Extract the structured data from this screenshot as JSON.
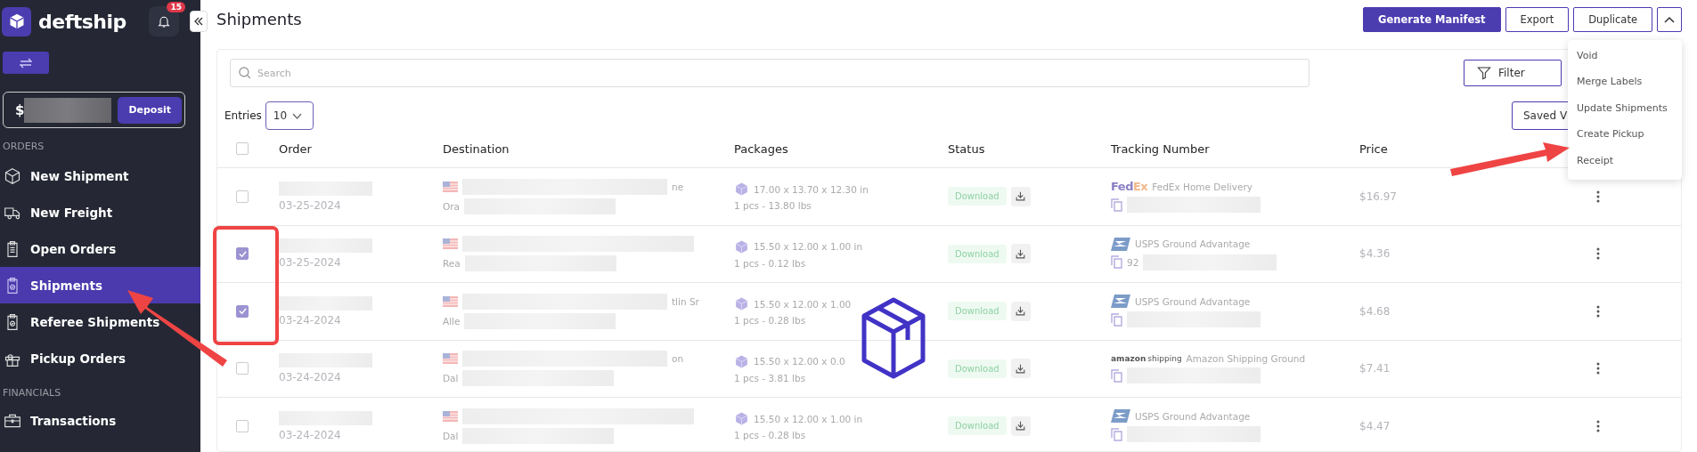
{
  "sidebar": {
    "brand": "deftship",
    "notification_count": "15",
    "balance_symbol": "$",
    "deposit_label": "Deposit",
    "sections": [
      {
        "title": "ORDERS",
        "items": [
          {
            "label": "New Shipment",
            "selected": false
          },
          {
            "label": "New Freight",
            "selected": false
          },
          {
            "label": "Open Orders",
            "selected": false
          },
          {
            "label": "Shipments",
            "selected": true
          },
          {
            "label": "Referee Shipments",
            "selected": false
          },
          {
            "label": "Pickup Orders",
            "selected": false
          }
        ]
      },
      {
        "title": "FINANCIALS",
        "items": [
          {
            "label": "Transactions",
            "selected": false
          }
        ]
      }
    ]
  },
  "page": {
    "title": "Shipments",
    "actions": [
      {
        "label": "Generate Manifest",
        "primary": true
      },
      {
        "label": "Export",
        "primary": false
      },
      {
        "label": "Duplicate",
        "primary": false
      }
    ],
    "menu": {
      "expanded": true,
      "items": [
        "Void",
        "Merge Labels",
        "Update Shipments",
        "Create Pickup",
        "Receipt"
      ]
    }
  },
  "toolbar": {
    "search_placeholder": "Search",
    "filter_label": "Filter",
    "entries_label": "Entries",
    "entries_value": "10",
    "saved_views_label": "Saved V"
  },
  "table": {
    "columns": [
      "Order",
      "Destination",
      "Packages",
      "Status",
      "Tracking Number",
      "Price"
    ],
    "all_selected": false,
    "rows": [
      {
        "selected": false,
        "date": "03-25-2024",
        "dest_start": "Ora",
        "dest_end": "ne",
        "dims": "17.00 x 13.70 x 12.30 in",
        "weight": "1 pcs - 13.80 lbs",
        "status": "Download",
        "kind": "fedex",
        "logo": [
          "Fed",
          "Ex"
        ],
        "service": "FedEx Home Delivery",
        "tracking_start": "",
        "price": "$16.97"
      },
      {
        "selected": true,
        "date": "03-25-2024",
        "dest_start": "Rea",
        "dest_end": "",
        "dims": "15.50 x 12.00 x 1.00 in",
        "weight": "1 pcs - 0.12 lbs",
        "status": "Download",
        "kind": "usps",
        "service": "USPS Ground Advantage",
        "tracking_start": "92",
        "price": "$4.36"
      },
      {
        "selected": true,
        "date": "03-24-2024",
        "dest_start": "Alle",
        "dest_end": "tlin Sr",
        "dims": "15.50 x 12.00 x 1.00",
        "weight": "1 pcs - 0.28 lbs",
        "status": "Download",
        "kind": "usps",
        "service": "USPS Ground Advantage",
        "tracking_start": "",
        "price": "$4.68"
      },
      {
        "selected": false,
        "date": "03-24-2024",
        "dest_start": "Dal",
        "dest_end": "on",
        "dims": "15.50 x 12.00 x 0.0",
        "weight": "1 pcs - 3.81 lbs",
        "status": "Download",
        "kind": "amazon",
        "logo": [
          "amazon",
          "shipping"
        ],
        "service": "Amazon Shipping Ground",
        "tracking_start": "",
        "price": "$7.41"
      },
      {
        "selected": false,
        "date": "03-24-2024",
        "dest_start": "Dal",
        "dest_end": "",
        "dims": "15.50 x 12.00 x 1.00 in",
        "weight": "1 pcs - 0.28 lbs",
        "status": "Download",
        "kind": "usps",
        "service": "USPS Ground Advantage",
        "tracking_start": "",
        "price": "$4.47"
      }
    ]
  }
}
